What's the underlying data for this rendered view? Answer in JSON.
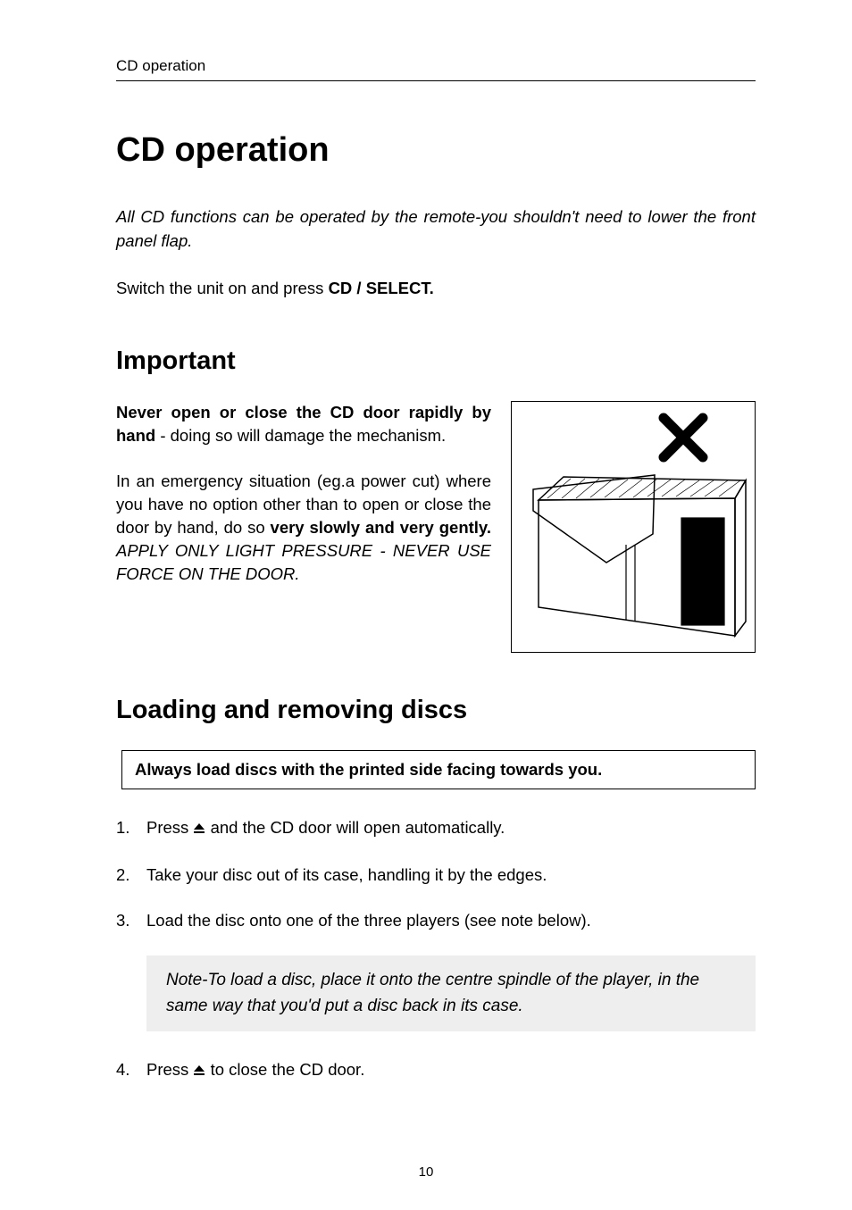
{
  "header": {
    "running": "CD operation"
  },
  "title": "CD operation",
  "intro": "All CD functions can be operated by the remote-you shouldn't need to lower the front panel flap.",
  "switch": {
    "pre": "Switch the unit on and press ",
    "bold": "CD / SELECT."
  },
  "section_important": "Important",
  "important_p1": {
    "bold1": "Never open or close the CD door rapidly by hand",
    "rest": " - doing so will damage the mechanism."
  },
  "important_p2": {
    "lead": "In an emergency situation (eg.a power cut) where you have no option other than to open or close the door by hand, do so ",
    "bold": "very slowly and very gently.",
    "ital": " APPLY ONLY LIGHT PRESSURE - NEVER USE FORCE ON THE DOOR."
  },
  "section_loading": "Loading and removing discs",
  "notice": "Always load discs with the printed side facing towards you.",
  "steps": {
    "s1_pre": "Press ",
    "s1_post": " and the CD door will open automatically.",
    "s2": "Take your disc out of its case, handling it by the edges.",
    "s3": "Load the disc onto one of the three players (see note below).",
    "s4_pre": "Press ",
    "s4_post": " to close the CD door."
  },
  "step_numbers": {
    "n1": "1.",
    "n2": "2.",
    "n3": "3.",
    "n4": "4."
  },
  "note": "Note-To load a disc, place it onto the centre spindle of the player, in the same way that you'd put a disc back in its case.",
  "page_number": "10"
}
